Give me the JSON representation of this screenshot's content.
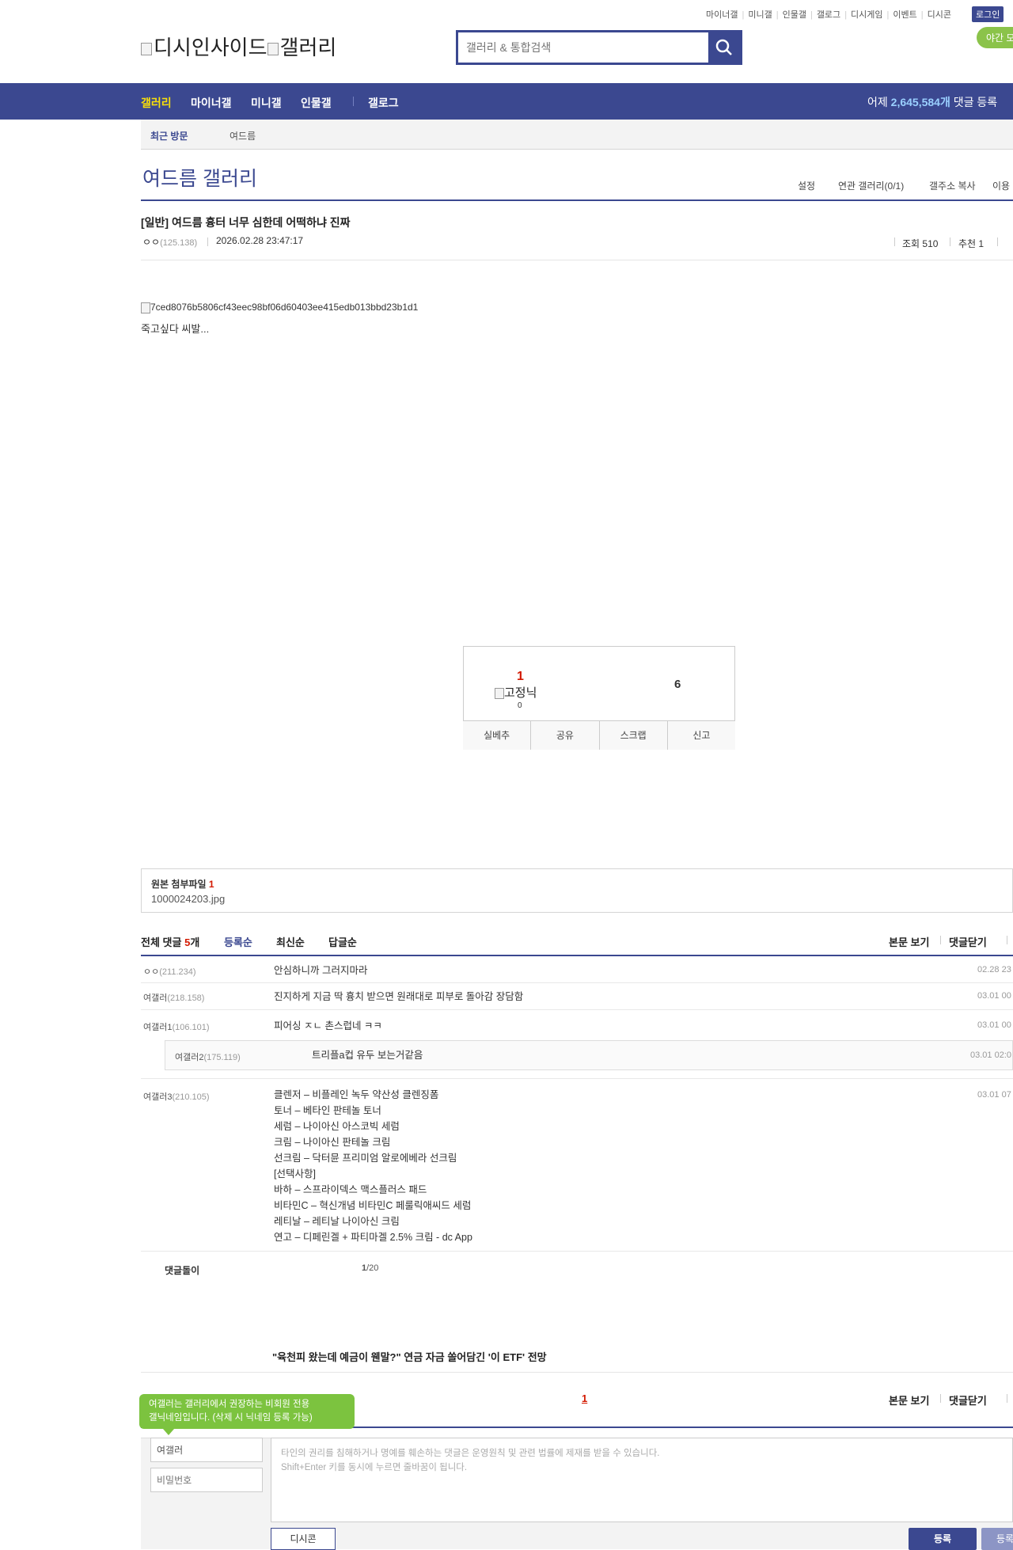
{
  "top_links": [
    "마이너갤",
    "미니갤",
    "인물갤",
    "갤로그",
    "디시게임",
    "이벤트",
    "디시콘"
  ],
  "login_label": "로그인",
  "night_mode_label": "야간 모",
  "logo": {
    "alt1": "디시인사이드",
    "alt2": "갤러리"
  },
  "search": {
    "placeholder": "갤러리 & 통합검색"
  },
  "gnb": {
    "items": [
      "갤러리",
      "마이너갤",
      "미니갤",
      "인물갤",
      "갤로그"
    ],
    "stat_prefix": "어제",
    "stat_count": "2,645,584개",
    "stat_suffix": "댓글 등록"
  },
  "recent_visit": {
    "label": "최근 방문",
    "items": [
      "여드름"
    ]
  },
  "gallery": {
    "title": "여드름 갤러리",
    "menu": [
      "설정",
      "연관 갤러리(0/1)",
      "갤주소 복사",
      "이용"
    ]
  },
  "post": {
    "title": "[일반] 여드름 흉터 너무 심한데 어떡하냐 진짜",
    "writer": "ㅇㅇ",
    "writer_ip": "(125.138)",
    "date": "2026.02.28 23:47:17",
    "views": "조회 510",
    "recommends": "추천 1",
    "image_alt": "7ced8076b5806cf43eec98bf06d60403ee415edb013bbd23b1d1",
    "body": "죽고싶다 씨발..."
  },
  "recommend_box": {
    "up_count": "1",
    "fixnick_alt": "고정닉",
    "fixnick_count": "0",
    "down_count": "6",
    "buttons": [
      "실베추",
      "공유",
      "스크랩",
      "신고"
    ]
  },
  "attachment": {
    "label": "원본 첨부파일",
    "count": "1",
    "file": "1000024203.jpg"
  },
  "comments_header": {
    "total_prefix": "전체 댓글",
    "total_count": "5",
    "total_suffix": "개",
    "sorts": [
      "등록순",
      "최신순",
      "답글순"
    ],
    "right": [
      "본문 보기",
      "댓글닫기"
    ]
  },
  "comments": [
    {
      "nick": "ㅇㅇ",
      "ip": "(211.234)",
      "text": "안심하니까 그러지마라",
      "date": "02.28 23"
    },
    {
      "nick": "여갤러",
      "ip": "(218.158)",
      "text": "진지하게 지금 딱 흉치 받으면 원래대로 피부로 돌아감 장담함",
      "date": "03.01 00"
    },
    {
      "nick": "여갤러1",
      "ip": "(106.101)",
      "text": "피어싱 ㅈㄴ 촌스럽네 ㅋㅋ",
      "date": "03.01 00"
    },
    {
      "nick": "여갤러2",
      "ip": "(175.119)",
      "text": "트리플a컵 유두 보는거같음",
      "date": "03.01 02:0",
      "reply": true
    },
    {
      "nick": "여갤러3",
      "ip": "(210.105)",
      "date": "03.01 07",
      "lines": [
        "클렌저 – 비플레인 녹두 약산성 클렌징폼",
        "토너 – 베타인 판테놀 토너",
        "세럼 – 나이아신 아스코빅 세럼",
        "크림 – 나이아신 판테놀 크림",
        "선크림 – 닥터뮨 프리미엄 알로에베라 선크림",
        "[선택사항]",
        "바하 – 스프라이덱스 맥스플러스 패드",
        "비타민C – 혁신개념 비타민C 페룰릭애씨드 세럼",
        "레티날 – 레티날 나이아신 크림",
        "연고 – 디페린겔 + 파티마겔 2.5% 크림 - dc App"
      ]
    }
  ],
  "comment_footer": {
    "label": "댓글돌이",
    "page_current": "1",
    "page_total": "/20"
  },
  "ad_link": "\"육천피 왔는데 예금이 웬말?\" 연금 자금 쏠어담긴 '이 ETF' 전망",
  "pagination": {
    "current": "1"
  },
  "write": {
    "tooltip_line1": "여갤러는 갤러리에서 권장하는 비회원 전용",
    "tooltip_line2": "갤닉네임입니다. (삭제 시 닉네임 등록 가능)",
    "nick_value": "여갤러",
    "password_placeholder": "비밀번호",
    "textarea_line1": "타인의 권리를 침해하거나 명예를 훼손하는 댓글은 운영원칙 및 관련 법률에 제재를 받을 수 있습니다.",
    "textarea_line2": "Shift+Enter 키를 동시에 누르면 줄바꿈이 됩니다.",
    "dccon_label": "디시콘",
    "submit_label": "등록",
    "submit2_label": "등록"
  },
  "colors": {
    "brand": "#3b4890",
    "accent_red": "#d31900",
    "nav_active": "#f9df0a",
    "night_green": "#8bc34a"
  }
}
